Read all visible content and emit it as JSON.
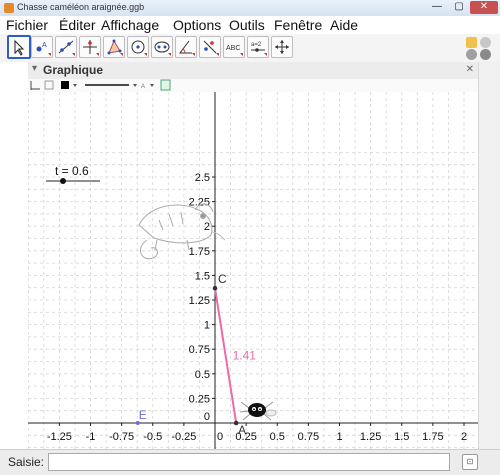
{
  "window": {
    "title": "Chasse caméléon araignée.ggb",
    "minimize": "—",
    "maximize": "▢",
    "close": "✕"
  },
  "menu": [
    "Fichier",
    "Éditer",
    "Affichage",
    "Options",
    "Outils",
    "Fenêtre",
    "Aide"
  ],
  "toolbar": {
    "tools": [
      "move-tool",
      "point-tool",
      "line-tool",
      "perpendicular-line-tool",
      "polygon-tool",
      "circle-tool",
      "ellipse-tool",
      "angle-tool",
      "reflect-tool",
      "text-tool",
      "slider-tool",
      "move-view-tool"
    ],
    "text_tool_label": "ABC",
    "slider_tool_label": "a=2"
  },
  "graphics_view": {
    "title": "Graphique"
  },
  "slider": {
    "label": "t = 0.6",
    "value": 0.6
  },
  "graph": {
    "x_ticks": [
      "-1.25",
      "-1",
      "-0.75",
      "-0.5",
      "-0.25",
      "0",
      "0.25",
      "0.5",
      "0.75",
      "1",
      "1.25",
      "1.5",
      "1.75",
      "2"
    ],
    "y_ticks": [
      "0",
      "0.25",
      "0.5",
      "0.75",
      "1",
      "1.25",
      "1.5",
      "1.75",
      "2",
      "2.25",
      "2.5"
    ],
    "points": [
      {
        "name": "A",
        "x": 0.17,
        "y": 0
      },
      {
        "name": "C",
        "x": 0,
        "y": 1.37
      },
      {
        "name": "E",
        "x": -0.62,
        "y": 0
      }
    ],
    "segment_label": "1.41",
    "segment_color": "#ee6aa7"
  },
  "input_bar": {
    "label": "Saisie:",
    "value": "",
    "keyboard_icon": "⊡"
  }
}
